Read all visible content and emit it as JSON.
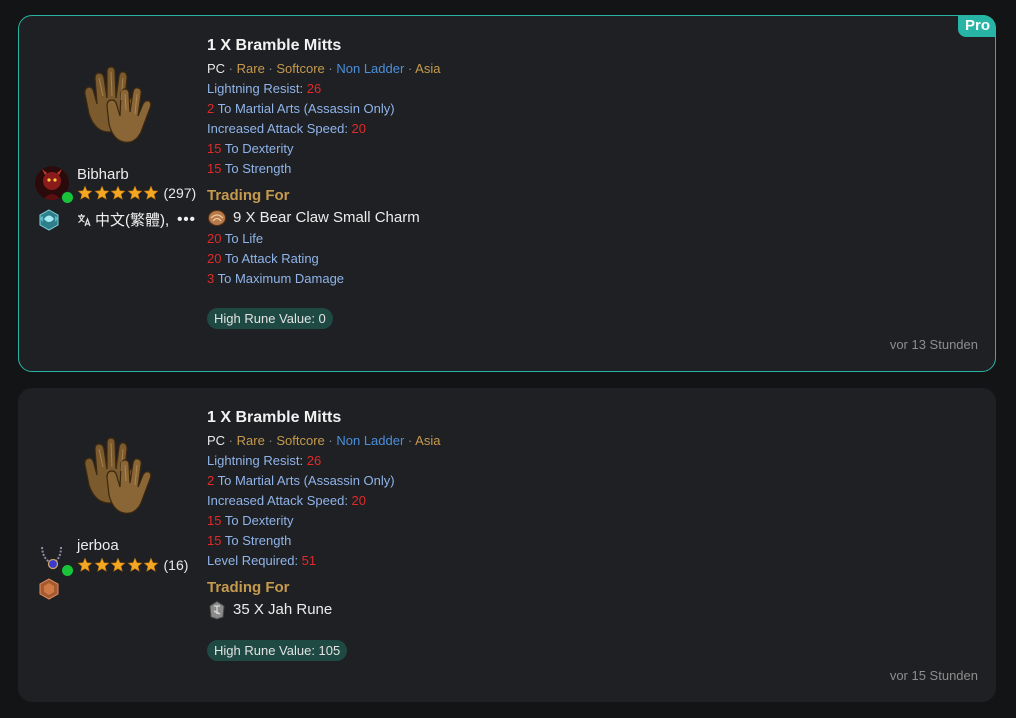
{
  "listings": [
    {
      "pro_label": "Pro",
      "title": "1 X Bramble Mitts",
      "meta": {
        "platform": "PC",
        "sep": " · ",
        "rarity": "Rare",
        "mode": "Softcore",
        "ladder": "Non Ladder",
        "region": "Asia"
      },
      "stats": [
        {
          "label": "Lightning Resist: ",
          "value": "26",
          "value_first": false
        },
        {
          "value": "2",
          "label": " To Martial Arts (Assassin Only)",
          "value_first": true
        },
        {
          "label": "Increased Attack Speed: ",
          "value": "20",
          "value_first": false
        },
        {
          "value": "15",
          "label": " To Dexterity",
          "value_first": true
        },
        {
          "value": "15",
          "label": " To Strength",
          "value_first": true
        }
      ],
      "seller": {
        "name": "Bibharb",
        "rating_count": "(297)",
        "language": "中文(繁體),",
        "more": "•••",
        "avatar_icon": "demon-avatar-icon",
        "rank_icon": "teal-rank-badge-icon"
      },
      "trading_for_label": "Trading For",
      "trade": {
        "item": "9 X Bear Claw Small Charm",
        "icon": "small-charm-icon",
        "stats": [
          {
            "value": "20",
            "label": " To Life"
          },
          {
            "value": "20",
            "label": " To Attack Rating"
          },
          {
            "value": "3",
            "label": " To Maximum Damage"
          }
        ]
      },
      "rune_value": "High Rune Value: 0",
      "time": "vor 13 Stunden"
    },
    {
      "title": "1 X Bramble Mitts",
      "meta": {
        "platform": "PC",
        "sep": " · ",
        "rarity": "Rare",
        "mode": "Softcore",
        "ladder": "Non Ladder",
        "region": "Asia"
      },
      "stats": [
        {
          "label": "Lightning Resist: ",
          "value": "26",
          "value_first": false
        },
        {
          "value": "2",
          "label": " To Martial Arts (Assassin Only)",
          "value_first": true
        },
        {
          "label": "Increased Attack Speed: ",
          "value": "20",
          "value_first": false
        },
        {
          "value": "15",
          "label": " To Dexterity",
          "value_first": true
        },
        {
          "value": "15",
          "label": " To Strength",
          "value_first": true
        },
        {
          "label": "Level Required: ",
          "value": "51",
          "value_first": false
        }
      ],
      "seller": {
        "name": "jerboa",
        "rating_count": "(16)",
        "avatar_icon": "amulet-avatar-icon",
        "rank_icon": "bronze-rank-badge-icon"
      },
      "trading_for_label": "Trading For",
      "trade": {
        "item": "35 X Jah Rune",
        "icon": "jah-rune-icon",
        "stats": []
      },
      "rune_value": "High Rune Value: 105",
      "time": "vor 15 Stunden"
    }
  ],
  "colors": {
    "accent": "#2bb3a3",
    "stat_blue": "#8fb4ea",
    "stat_red": "#e02a2a",
    "gold": "#c69a4d",
    "star": "#f5a623",
    "online": "#19c43a"
  }
}
